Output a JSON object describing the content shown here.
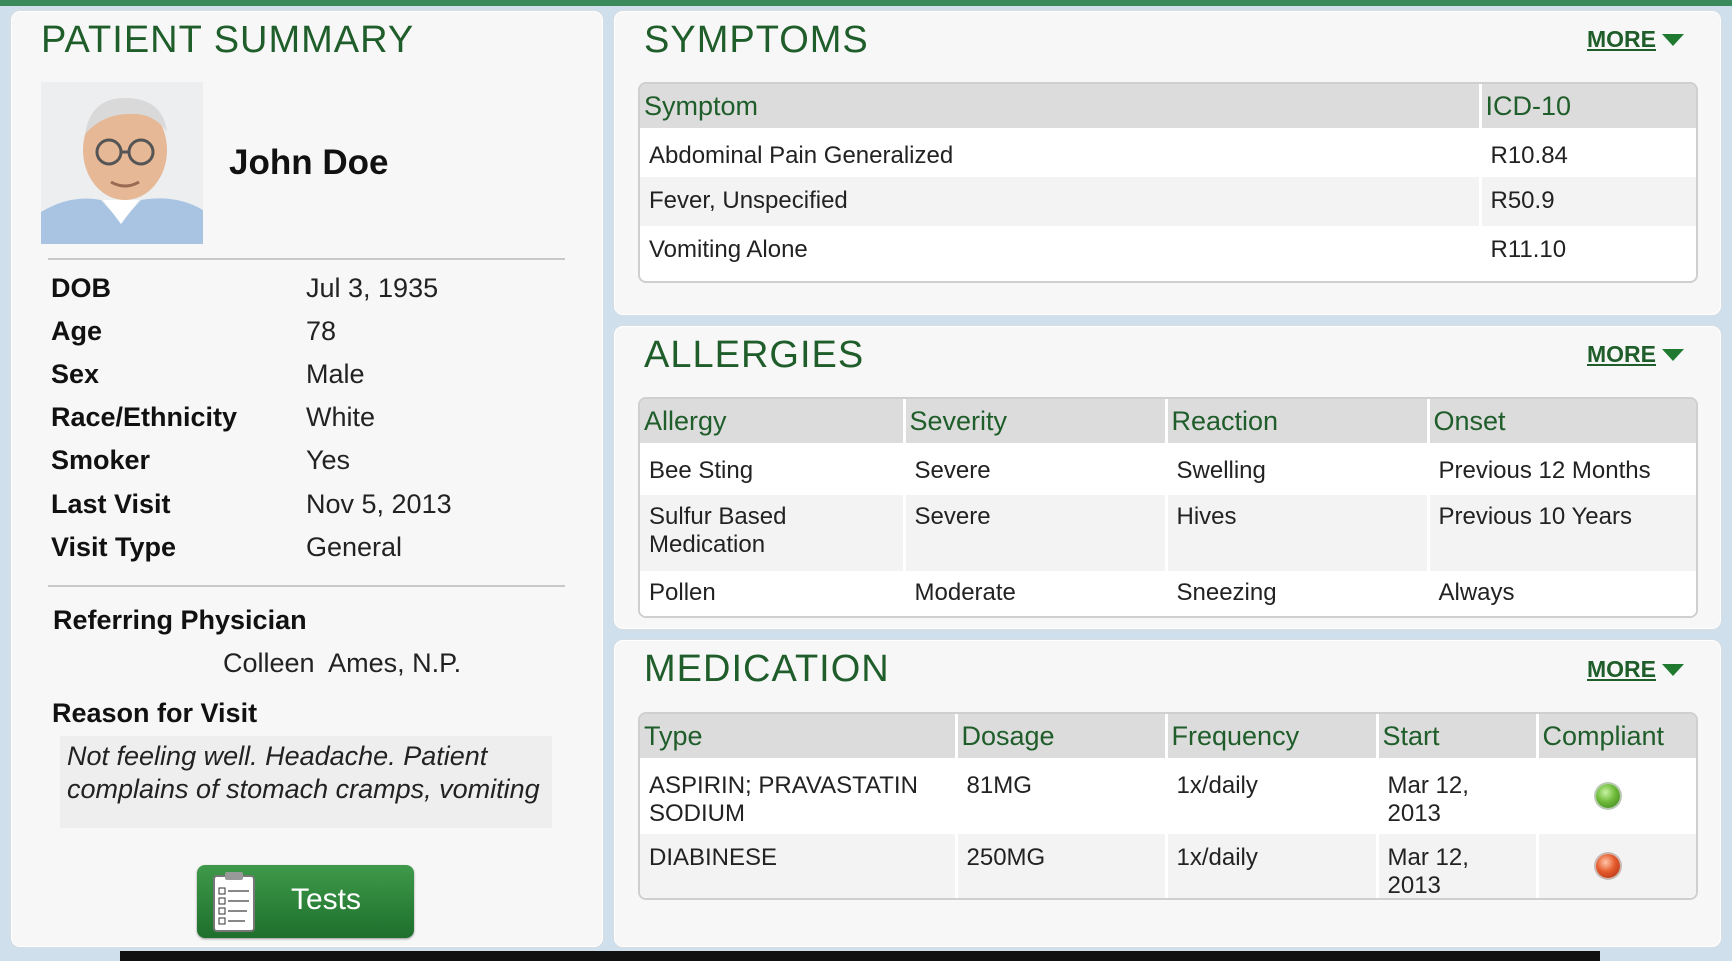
{
  "patient_summary": {
    "title": "PATIENT SUMMARY",
    "name": "John Doe",
    "fields": [
      {
        "label": "DOB",
        "value": "Jul 3, 1935"
      },
      {
        "label": "Age",
        "value": "78"
      },
      {
        "label": "Sex",
        "value": "Male"
      },
      {
        "label": "Race/Ethnicity",
        "value": "White"
      },
      {
        "label": "Smoker",
        "value": "Yes"
      },
      {
        "label": "Last Visit",
        "value": "Nov 5, 2013"
      },
      {
        "label": "Visit Type",
        "value": "General"
      }
    ],
    "referring_physician_label": "Referring Physician",
    "referring_physician": "Colleen  Ames, N.P.",
    "reason_label": "Reason for Visit",
    "reason_text": "Not feeling well. Headache. Patient complains of stomach cramps, vomiting",
    "tests_button": "Tests"
  },
  "symptoms": {
    "title": "SYMPTOMS",
    "more": "MORE",
    "headers": [
      "Symptom",
      "ICD-10"
    ],
    "rows": [
      [
        "Abdominal Pain Generalized",
        "R10.84"
      ],
      [
        "Fever, Unspecified",
        "R50.9"
      ],
      [
        "Vomiting Alone",
        "R11.10"
      ]
    ]
  },
  "allergies": {
    "title": "ALLERGIES",
    "more": "MORE",
    "headers": [
      "Allergy",
      "Severity",
      "Reaction",
      "Onset"
    ],
    "rows": [
      [
        "Bee Sting",
        "Severe",
        "Swelling",
        "Previous 12 Months"
      ],
      [
        "Sulfur Based Medication",
        "Severe",
        "Hives",
        "Previous 10 Years"
      ],
      [
        "Pollen",
        "Moderate",
        "Sneezing",
        "Always"
      ]
    ]
  },
  "medication": {
    "title": "MEDICATION",
    "more": "MORE",
    "headers": [
      "Type",
      "Dosage",
      "Frequency",
      "Start",
      "Compliant"
    ],
    "rows": [
      {
        "type": "ASPIRIN; PRAVASTATIN SODIUM",
        "dosage": "81MG",
        "frequency": "1x/daily",
        "start": "Mar 12, 2013",
        "compliant": "green"
      },
      {
        "type": "DIABINESE",
        "dosage": "250MG",
        "frequency": "1x/daily",
        "start": "Mar 12, 2013",
        "compliant": "red"
      }
    ]
  },
  "colors": {
    "accent_green": "#1f5d2a",
    "button_green": "#2e8a3c",
    "compliant_yes": "#6fbb3a",
    "compliant_no": "#e55a2b"
  }
}
